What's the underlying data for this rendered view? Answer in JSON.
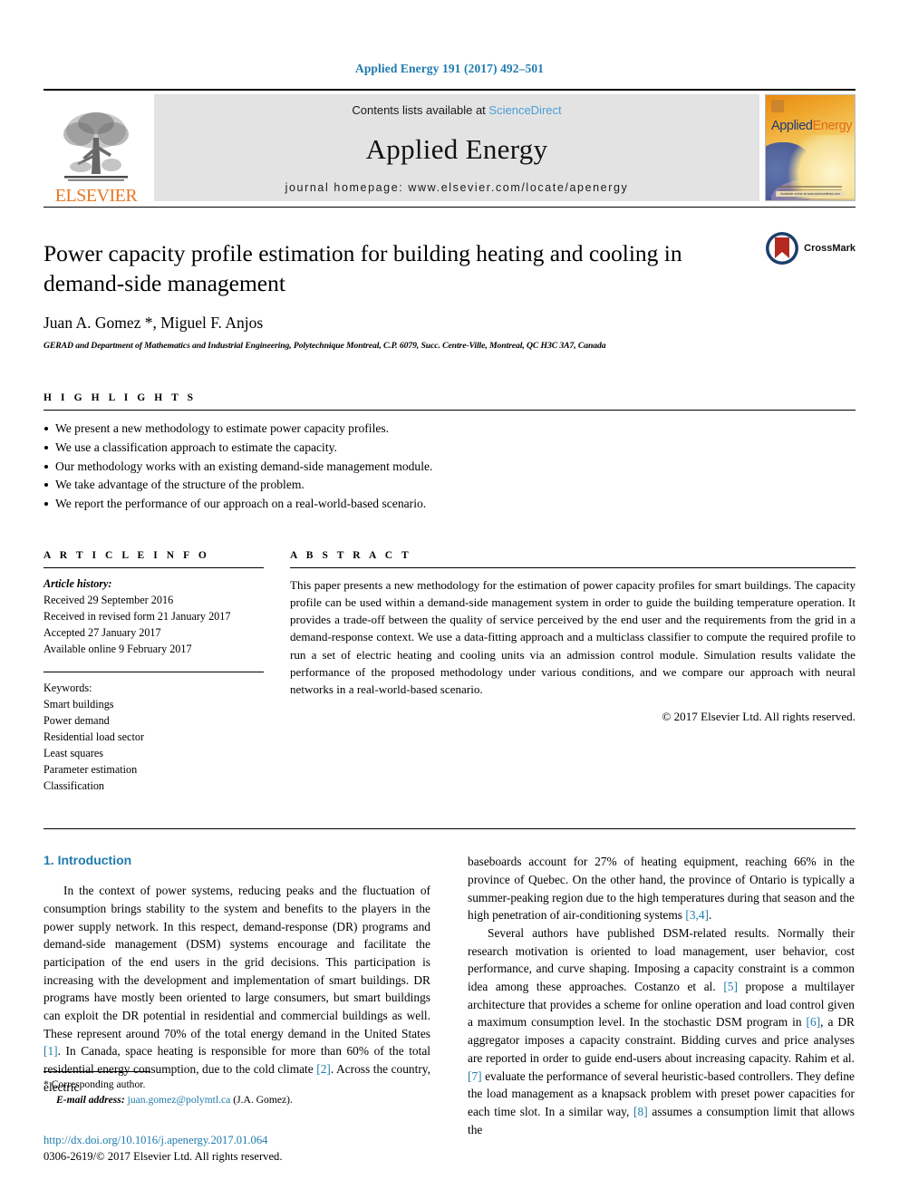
{
  "running_head": "Applied Energy 191 (2017) 492–501",
  "masthead": {
    "contents_prefix": "Contents lists available at",
    "contents_link": "ScienceDirect",
    "journal_name": "Applied Energy",
    "homepage": "journal homepage: www.elsevier.com/locate/apenergy",
    "publisher_wordmark": "ELSEVIER",
    "cover_title_a": "Applied",
    "cover_title_b": "Energy",
    "cover_badge": "Available online at www.sciencedirect.com"
  },
  "article": {
    "title": "Power capacity profile estimation for building heating and cooling in demand-side management",
    "authors": "Juan A. Gomez *, Miguel F. Anjos",
    "affiliation": "GERAD and Department of Mathematics and Industrial Engineering, Polytechnique Montreal, C.P. 6079, Succ. Centre-Ville, Montreal, QC H3C 3A7, Canada",
    "crossmark_label": "CrossMark"
  },
  "highlights": {
    "heading": "H I G H L I G H T S",
    "items": [
      "We present a new methodology to estimate power capacity profiles.",
      "We use a classification approach to estimate the capacity.",
      "Our methodology works with an existing demand-side management module.",
      "We take advantage of the structure of the problem.",
      "We report the performance of our approach on a real-world-based scenario."
    ]
  },
  "article_info": {
    "heading": "A R T I C L E    I N F O",
    "history_label": "Article history:",
    "history": [
      "Received 29 September 2016",
      "Received in revised form 21 January 2017",
      "Accepted 27 January 2017",
      "Available online 9 February 2017"
    ],
    "keywords_label": "Keywords:",
    "keywords": [
      "Smart buildings",
      "Power demand",
      "Residential load sector",
      "Least squares",
      "Parameter estimation",
      "Classification"
    ]
  },
  "abstract": {
    "heading": "A B S T R A C T",
    "text": "This paper presents a new methodology for the estimation of power capacity profiles for smart buildings. The capacity profile can be used within a demand-side management system in order to guide the building temperature operation. It provides a trade-off between the quality of service perceived by the end user and the requirements from the grid in a demand-response context. We use a data-fitting approach and a multiclass classifier to compute the required profile to run a set of electric heating and cooling units via an admission control module. Simulation results validate the performance of the proposed methodology under various conditions, and we compare our approach with neural networks in a real-world-based scenario.",
    "copyright": "© 2017 Elsevier Ltd. All rights reserved."
  },
  "body": {
    "section_title": "1. Introduction",
    "left_paragraph_1_a": "In the context of power systems, reducing peaks and the fluctuation of consumption brings stability to the system and benefits to the players in the power supply network. In this respect, demand-response (DR) programs and demand-side management (DSM) systems encourage and facilitate the participation of the end users in the grid decisions. This participation is increasing with the development and implementation of smart buildings. DR programs have mostly been oriented to large consumers, but smart buildings can exploit the DR potential in residential and commercial buildings as well. These represent around 70% of the total energy demand in the United States ",
    "ref_1": "[1]",
    "left_paragraph_1_b": ". In Canada, space heating is responsible for more than 60% of the total residential energy consumption, due to the cold climate ",
    "ref_2": "[2]",
    "left_paragraph_1_c": ". Across the country, electric",
    "right_paragraph_1_a": "baseboards account for 27% of heating equipment, reaching 66% in the province of Quebec. On the other hand, the province of Ontario is typically a summer-peaking region due to the high temperatures during that season and the high penetration of air-conditioning systems ",
    "ref_34": "[3,4]",
    "right_paragraph_1_b": ".",
    "right_paragraph_2_a": "Several authors have published DSM-related results. Normally their research motivation is oriented to load management, user behavior, cost performance, and curve shaping. Imposing a capacity constraint is a common idea among these approaches. Costanzo et al. ",
    "ref_5": "[5]",
    "right_paragraph_2_b": " propose a multilayer architecture that provides a scheme for online operation and load control given a maximum consumption level. In the stochastic DSM program in ",
    "ref_6": "[6]",
    "right_paragraph_2_c": ", a DR aggregator imposes a capacity constraint. Bidding curves and price analyses are reported in order to guide end-users about increasing capacity. Rahim et al. ",
    "ref_7": "[7]",
    "right_paragraph_2_d": " evaluate the performance of several heuristic-based controllers. They define the load management as a knapsack problem with preset power capacities for each time slot. In a similar way, ",
    "ref_8": "[8]",
    "right_paragraph_2_e": " assumes a consumption limit that allows the"
  },
  "footer": {
    "corresponding_author": "* Corresponding author.",
    "email_label": "E-mail address:",
    "email": "juan.gomez@polymtl.ca",
    "email_suffix": "(J.A. Gomez).",
    "doi": "http://dx.doi.org/10.1016/j.apenergy.2017.01.064",
    "issn": "0306-2619/© 2017 Elsevier Ltd. All rights reserved."
  },
  "colors": {
    "link_blue": "#1f7bad",
    "sciencedirect_blue": "#4a9fd5",
    "elsevier_orange": "#e87722"
  }
}
